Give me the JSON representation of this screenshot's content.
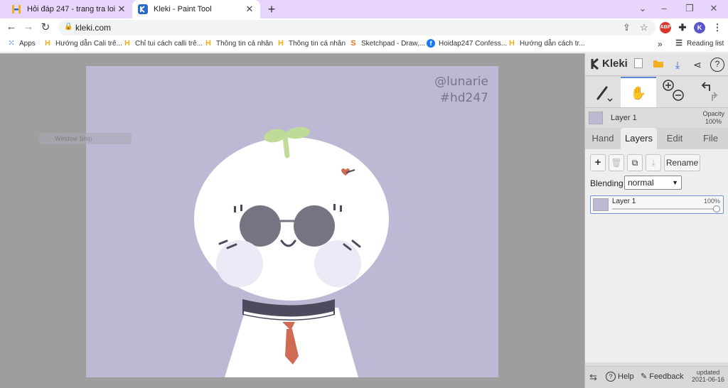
{
  "browser": {
    "tabs": [
      {
        "title": "Hỏi đáp 247 - trang tra loi",
        "active": false
      },
      {
        "title": "Kleki - Paint Tool",
        "active": true
      }
    ],
    "address": "kleki.com",
    "profile_initial": "K",
    "abp_label": "ABP"
  },
  "bookmarks": {
    "items": [
      {
        "label": "Apps",
        "icon": "apps-grid-icon"
      },
      {
        "label": "Hướng dẫn Cali trê...",
        "icon": "hoidap-h-icon"
      },
      {
        "label": "Chỉ tui cách calli trê...",
        "icon": "hoidap-h-icon"
      },
      {
        "label": "Thông tin cá nhân",
        "icon": "hoidap-h-icon"
      },
      {
        "label": "Thông tin cá nhân",
        "icon": "hoidap-h-icon"
      },
      {
        "label": "Sketchpad - Draw,...",
        "icon": "sketchpad-icon"
      },
      {
        "label": "Hoidap247 Confess...",
        "icon": "facebook-icon"
      },
      {
        "label": "Hướng dẫn cách tr...",
        "icon": "hoidap-h-icon"
      }
    ],
    "more": "»",
    "reading_list": "Reading list"
  },
  "canvas": {
    "watermark_line1": "@lunarie",
    "watermark_line2": "#hd247",
    "background": "#bdb9d4",
    "overlay_text": "Window Snip"
  },
  "kleki": {
    "logo_text": "Kleki",
    "layer_info": {
      "name": "Layer 1",
      "opacity_label": "Opacity",
      "opacity_value": "100%"
    },
    "tabs": [
      {
        "label": "Hand",
        "selected": false
      },
      {
        "label": "Layers",
        "selected": true
      },
      {
        "label": "Edit",
        "selected": false
      },
      {
        "label": "File",
        "selected": false
      }
    ],
    "rename_label": "Rename",
    "blending_label": "Blending",
    "blending_value": "normal",
    "layer": {
      "name": "Layer 1",
      "opacity": "100%"
    },
    "help_label": "Help",
    "feedback_label": "Feedback",
    "updated_label": "updated",
    "updated_date": "2021-06-16"
  },
  "colors": {
    "tabstrip": "#e8d5fb",
    "accent": "#5a8ad6",
    "canvas_bg": "#bdb9d4"
  }
}
